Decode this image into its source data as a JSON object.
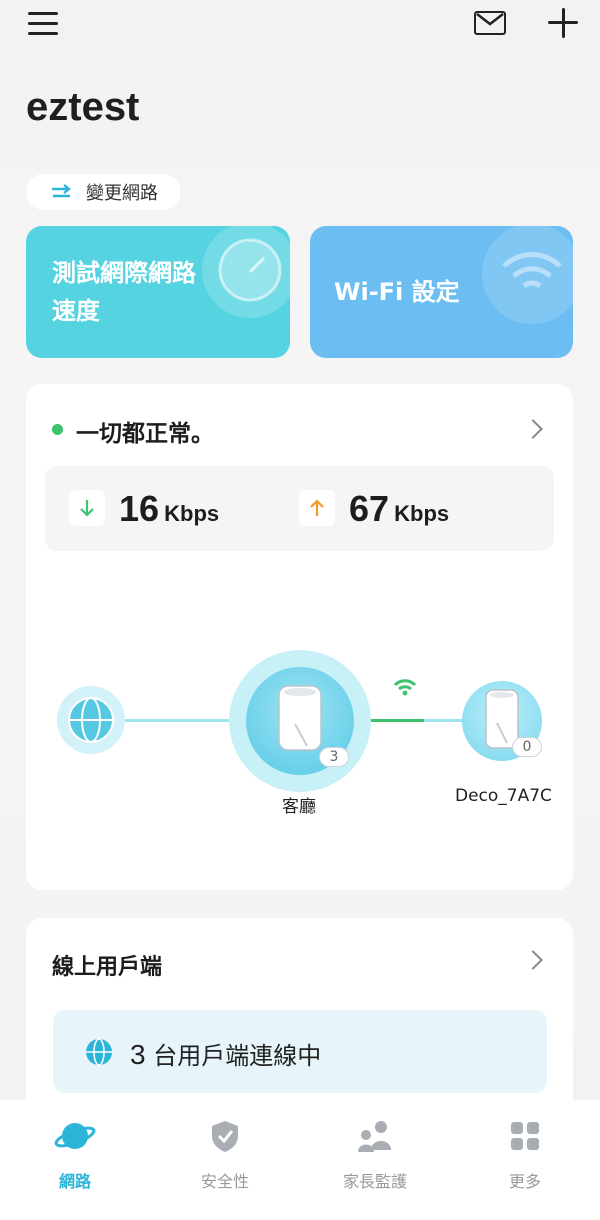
{
  "header": {
    "title": "eztest",
    "menu_icon": "hamburger-menu-icon",
    "mail_icon": "envelope-icon",
    "add_icon": "plus-icon"
  },
  "change_network": {
    "label": "變更網路",
    "icon": "swap-arrows-icon"
  },
  "tiles": {
    "speed_test": {
      "line1": "測試網際網路",
      "line2": "速度",
      "icon": "speedometer-icon"
    },
    "wifi_settings": {
      "label": "Wi-Fi 設定",
      "icon": "wifi-icon"
    }
  },
  "status_card": {
    "status": "一切都正常。",
    "download": {
      "value": "16",
      "unit": "Kbps",
      "icon": "down-arrow-icon"
    },
    "upload": {
      "value": "67",
      "unit": "Kbps",
      "icon": "up-arrow-icon"
    },
    "topology": {
      "internet_icon": "globe-icon",
      "main_node": {
        "label": "客廳",
        "client_count": "3"
      },
      "satellite_node": {
        "label": "Deco_7A7C",
        "client_count": "0"
      },
      "link_signal_icon": "wifi-signal-icon"
    }
  },
  "clients_card": {
    "title": "線上用戶端",
    "count": "3",
    "text": "台用戶端連線中",
    "icon": "globe-icon"
  },
  "bottom_nav": {
    "items": [
      {
        "label": "網路",
        "icon": "planet-icon",
        "active": true
      },
      {
        "label": "安全性",
        "icon": "shield-check-icon",
        "active": false
      },
      {
        "label": "家長監護",
        "icon": "family-icon",
        "active": false
      },
      {
        "label": "更多",
        "icon": "grid-icon",
        "active": false
      }
    ]
  },
  "colors": {
    "accent": "#2ab5d9",
    "speed_tile": "#55d3e0",
    "wifi_tile": "#6cbef2",
    "status_ok": "#3cc36b",
    "download_arrow": "#3cc36b",
    "upload_arrow": "#f29b26"
  }
}
